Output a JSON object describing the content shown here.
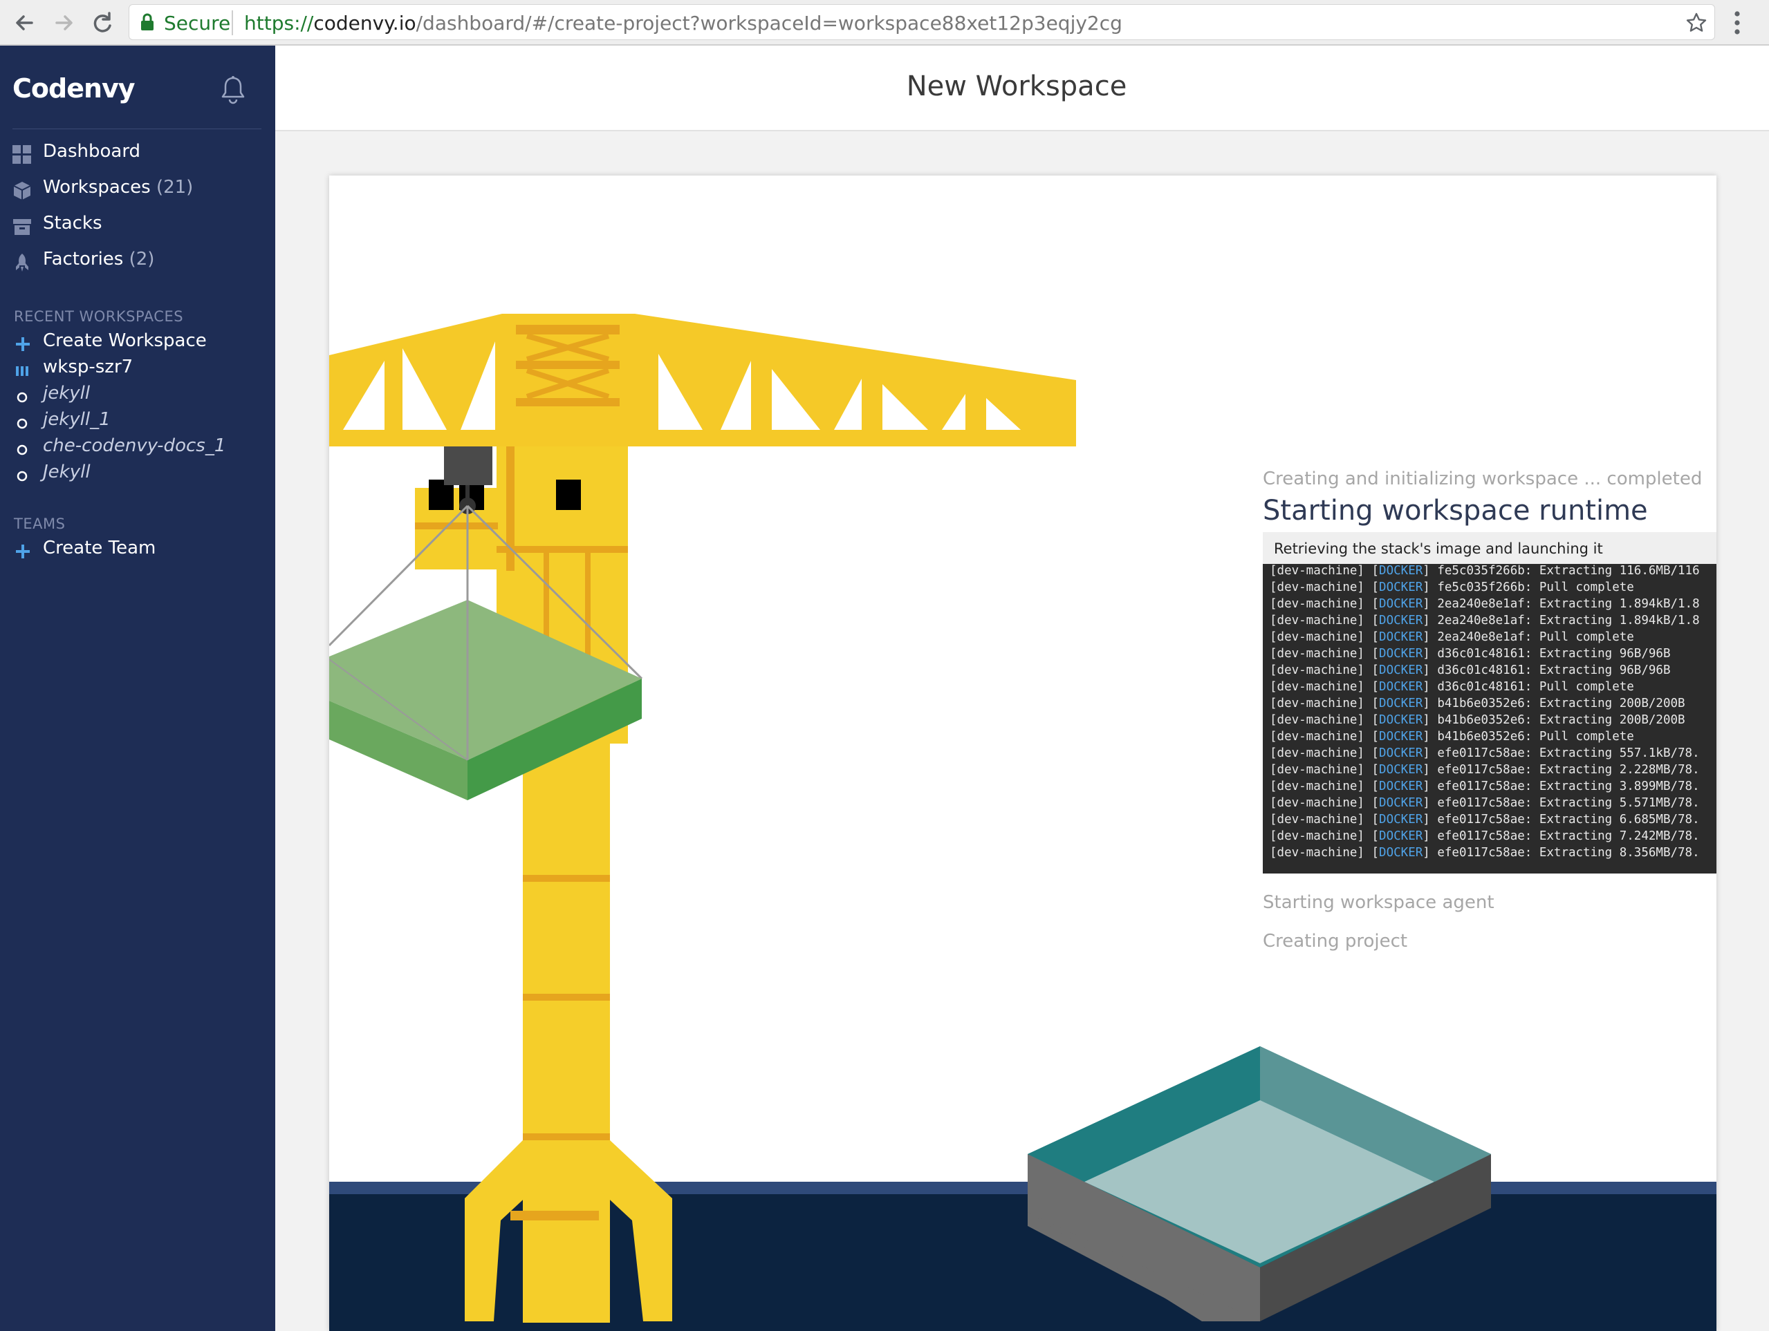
{
  "browser": {
    "secure_label": "Secure",
    "url_protocol": "https://",
    "url_host": "codenvy.io",
    "url_path": "/dashboard/#/create-project?workspaceId=workspace88xet12p3eqjy2cg"
  },
  "sidebar": {
    "brand": "Codenvy",
    "menu": [
      {
        "label": "Dashboard",
        "count": "",
        "icon": "dashboard-grid-icon"
      },
      {
        "label": "Workspaces",
        "count": "(21)",
        "icon": "workspaces-cube-icon"
      },
      {
        "label": "Stacks",
        "count": "",
        "icon": "stacks-box-icon"
      },
      {
        "label": "Factories",
        "count": "(2)",
        "icon": "factories-rocket-icon"
      }
    ],
    "recent_title": "RECENT WORKSPACES",
    "recent": [
      {
        "label": "Create Workspace",
        "icon": "plus-icon"
      },
      {
        "label": "wksp-szr7",
        "icon": "running-bars-icon"
      },
      {
        "label": "jekyll",
        "icon": "stopped-circle-icon"
      },
      {
        "label": "jekyll_1",
        "icon": "stopped-circle-icon"
      },
      {
        "label": "che-codenvy-docs_1",
        "icon": "stopped-circle-icon"
      },
      {
        "label": "Jekyll",
        "icon": "stopped-circle-icon"
      }
    ],
    "teams_title": "TEAMS",
    "create_team": "Create Team"
  },
  "main": {
    "title": "New Workspace",
    "steps": {
      "step1": "Creating and initializing workspace ... completed",
      "step2": "Starting workspace runtime",
      "step3": "Starting workspace agent",
      "step4": "Creating project"
    },
    "log": {
      "header": "Retrieving the stack's image and launching it",
      "lines": [
        {
          "prefix": "[dev-machine] [",
          "tag": "DOCKER",
          "msg": "] fe5c035f266b: Extracting 116.6MB/116"
        },
        {
          "prefix": "[dev-machine] [",
          "tag": "DOCKER",
          "msg": "] fe5c035f266b: Pull complete"
        },
        {
          "prefix": "[dev-machine] [",
          "tag": "DOCKER",
          "msg": "] 2ea240e8e1af: Extracting 1.894kB/1.8"
        },
        {
          "prefix": "[dev-machine] [",
          "tag": "DOCKER",
          "msg": "] 2ea240e8e1af: Extracting 1.894kB/1.8"
        },
        {
          "prefix": "[dev-machine] [",
          "tag": "DOCKER",
          "msg": "] 2ea240e8e1af: Pull complete"
        },
        {
          "prefix": "[dev-machine] [",
          "tag": "DOCKER",
          "msg": "] d36c01c48161: Extracting 96B/96B"
        },
        {
          "prefix": "[dev-machine] [",
          "tag": "DOCKER",
          "msg": "] d36c01c48161: Extracting 96B/96B"
        },
        {
          "prefix": "[dev-machine] [",
          "tag": "DOCKER",
          "msg": "] d36c01c48161: Pull complete"
        },
        {
          "prefix": "[dev-machine] [",
          "tag": "DOCKER",
          "msg": "] b41b6e0352e6: Extracting 200B/200B"
        },
        {
          "prefix": "[dev-machine] [",
          "tag": "DOCKER",
          "msg": "] b41b6e0352e6: Extracting 200B/200B"
        },
        {
          "prefix": "[dev-machine] [",
          "tag": "DOCKER",
          "msg": "] b41b6e0352e6: Pull complete"
        },
        {
          "prefix": "[dev-machine] [",
          "tag": "DOCKER",
          "msg": "] efe0117c58ae: Extracting 557.1kB/78."
        },
        {
          "prefix": "[dev-machine] [",
          "tag": "DOCKER",
          "msg": "] efe0117c58ae: Extracting 2.228MB/78."
        },
        {
          "prefix": "[dev-machine] [",
          "tag": "DOCKER",
          "msg": "] efe0117c58ae: Extracting 3.899MB/78."
        },
        {
          "prefix": "[dev-machine] [",
          "tag": "DOCKER",
          "msg": "] efe0117c58ae: Extracting 5.571MB/78."
        },
        {
          "prefix": "[dev-machine] [",
          "tag": "DOCKER",
          "msg": "] efe0117c58ae: Extracting 6.685MB/78."
        },
        {
          "prefix": "[dev-machine] [",
          "tag": "DOCKER",
          "msg": "] efe0117c58ae: Extracting 7.242MB/78."
        },
        {
          "prefix": "[dev-machine] [",
          "tag": "DOCKER",
          "msg": "] efe0117c58ae: Extracting 8.356MB/78."
        }
      ]
    }
  },
  "colors": {
    "sidebar_bg": "#1e2d55",
    "accent_blue": "#4fa3e8",
    "crane_yellow": "#f5c928",
    "water_navy": "#0c2340"
  }
}
